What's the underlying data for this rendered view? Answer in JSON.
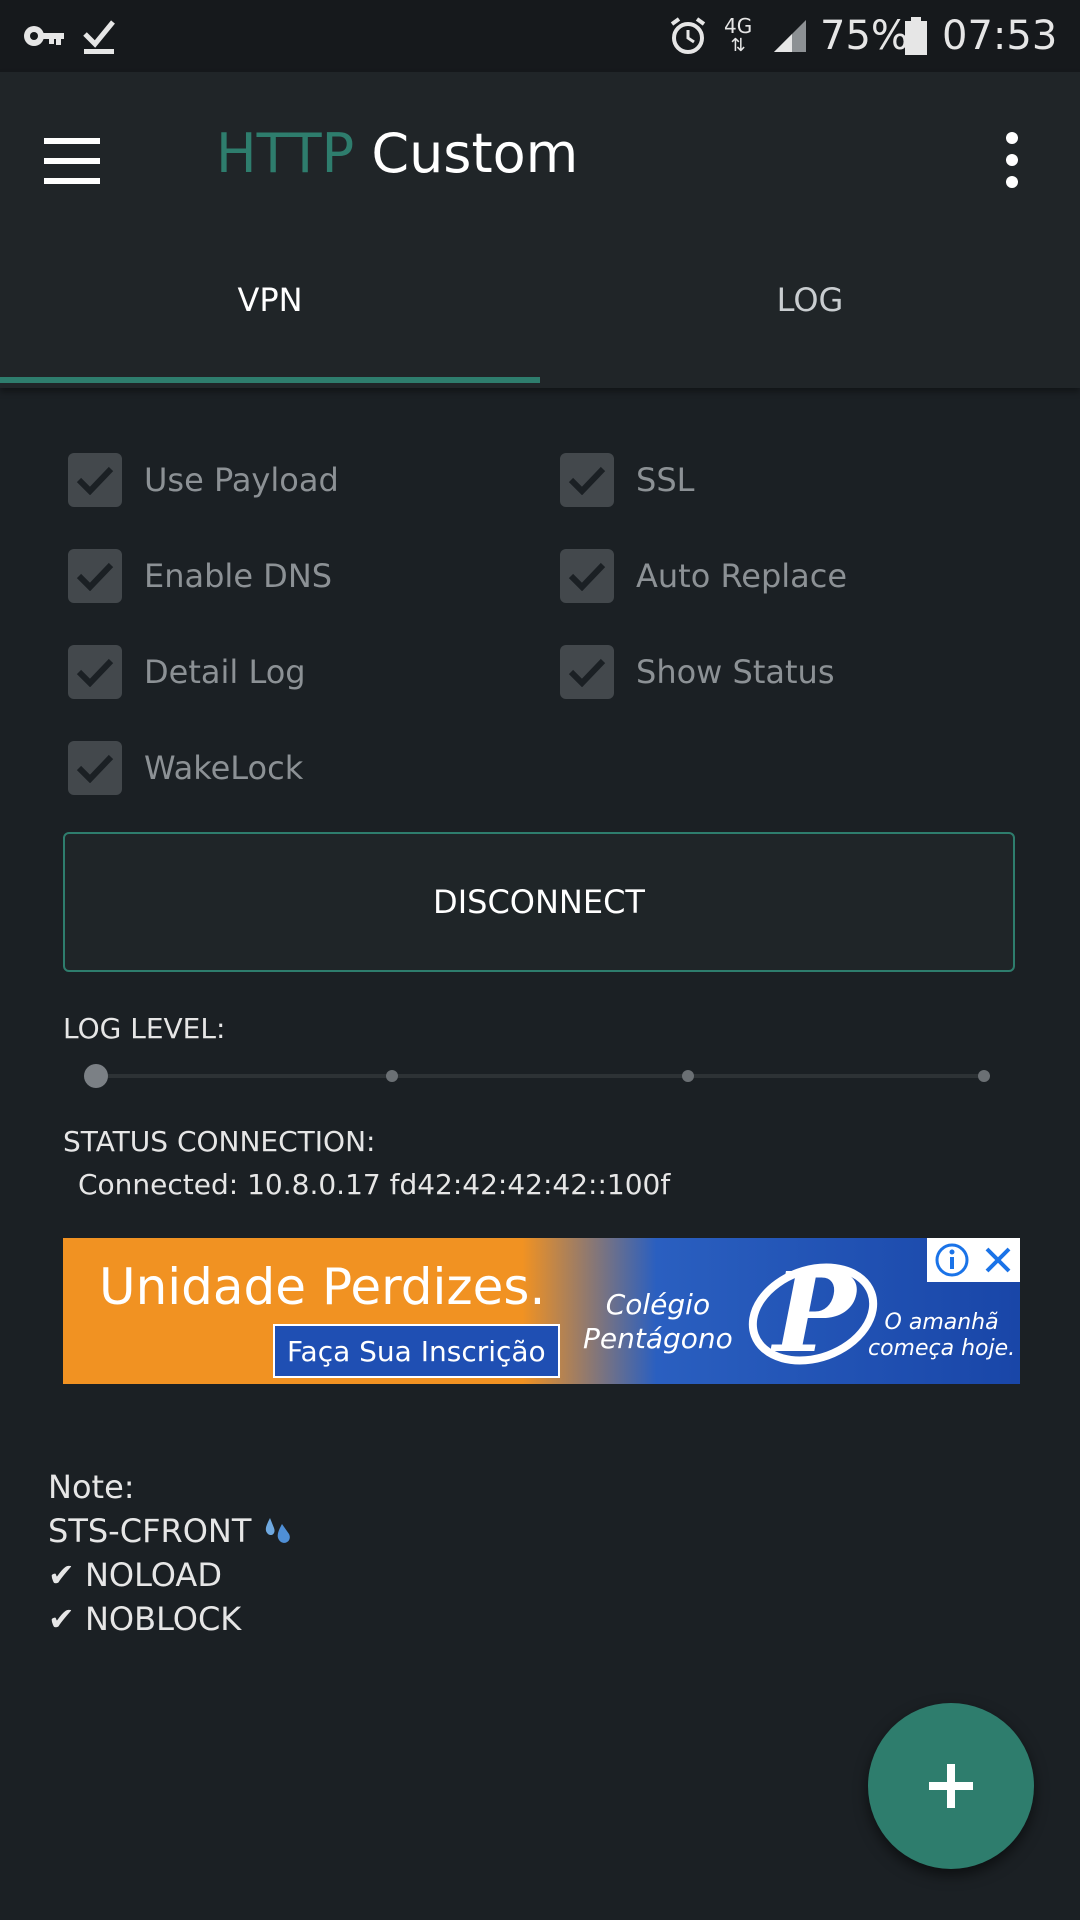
{
  "status_bar": {
    "left_icons": [
      "key-icon",
      "download-done-icon"
    ],
    "alarm_icon": "alarm-icon",
    "network": "4G",
    "battery_percent": "75%",
    "time": "07:53"
  },
  "app_bar": {
    "title_accent": "HTTP",
    "title_main": "Custom",
    "accent_color": "#2e7d6d"
  },
  "tabs": [
    {
      "label": "VPN",
      "selected": true
    },
    {
      "label": "LOG",
      "selected": false
    }
  ],
  "options": [
    {
      "label": "Use Payload",
      "checked": true
    },
    {
      "label": "SSL",
      "checked": true
    },
    {
      "label": "Enable DNS",
      "checked": true
    },
    {
      "label": "Auto Replace",
      "checked": true
    },
    {
      "label": "Detail Log",
      "checked": true
    },
    {
      "label": "Show Status",
      "checked": true
    },
    {
      "label": "WakeLock",
      "checked": true
    }
  ],
  "disconnect_label": "DISCONNECT",
  "log_level": {
    "label": "LOG LEVEL:",
    "value": 0,
    "steps": 4
  },
  "status": {
    "label": "STATUS CONNECTION:",
    "value": "Connected: 10.8.0.17 fd42:42:42:42::100f"
  },
  "ad": {
    "headline": "Unidade Perdizes.",
    "cta": "Faça Sua Inscrição",
    "brand_line1": "Colégio",
    "brand_line2": "Pentágono",
    "logo_letter": "P",
    "tagline_line1": "O amanhã",
    "tagline_line2": "começa hoje."
  },
  "notes": [
    "Note:",
    "STS-CFRONT",
    "NOLOAD",
    "NOBLOCK"
  ],
  "note_marks": {
    "drop_icon": "water-drop-icon",
    "check": "✔"
  },
  "fab_icon": "plus-icon"
}
